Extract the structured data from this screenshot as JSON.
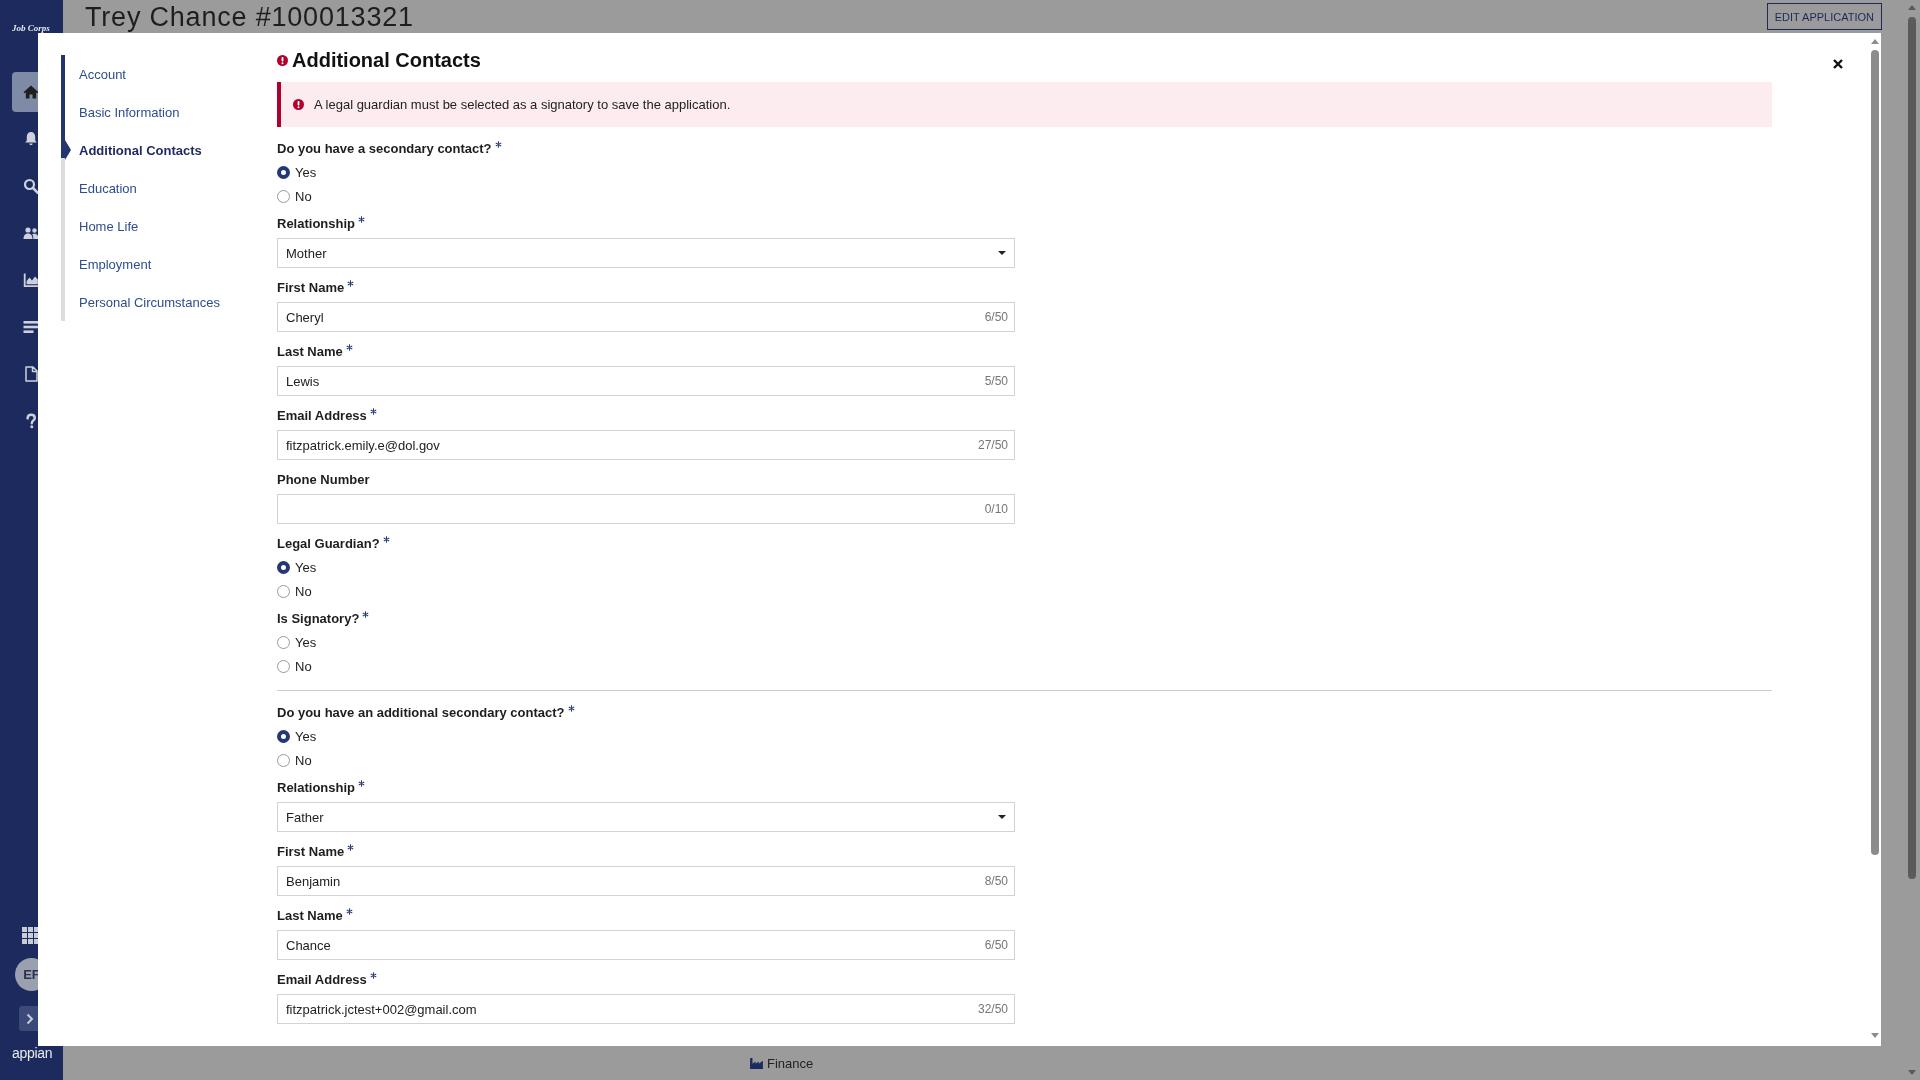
{
  "app_sidebar": {
    "logo": "Job Corps",
    "nav": [
      {
        "kind": "home",
        "selected": true
      },
      {
        "kind": "bell",
        "selected": false
      },
      {
        "kind": "search",
        "selected": false
      },
      {
        "kind": "people",
        "selected": false
      },
      {
        "kind": "chart",
        "selected": false
      },
      {
        "kind": "list",
        "selected": false
      },
      {
        "kind": "document",
        "selected": false
      },
      {
        "kind": "help",
        "selected": false
      }
    ],
    "avatar": "EF",
    "brand": "appian"
  },
  "page": {
    "title": "Trey Chance #100013321",
    "edit_button": "EDIT APPLICATION",
    "footer_link": "Finance"
  },
  "modal": {
    "nav": [
      {
        "label": "Account",
        "selected": false
      },
      {
        "label": "Basic Information",
        "selected": false
      },
      {
        "label": "Additional Contacts",
        "selected": true
      },
      {
        "label": "Education",
        "selected": false
      },
      {
        "label": "Home Life",
        "selected": false
      },
      {
        "label": "Employment",
        "selected": false
      },
      {
        "label": "Personal Circumstances",
        "selected": false
      }
    ],
    "title": "Additional Contacts",
    "has_error": true,
    "error_banner": "A legal guardian must be selected as a signatory to save the application.",
    "sections": [
      {
        "fields": [
          {
            "kind": "radio",
            "label": "Do you have a secondary contact?",
            "required": true,
            "options": [
              {
                "label": "Yes",
                "selected": true
              },
              {
                "label": "No",
                "selected": false
              }
            ]
          },
          {
            "kind": "select",
            "label": "Relationship",
            "required": true,
            "value": "Mother"
          },
          {
            "kind": "text",
            "label": "First Name",
            "required": true,
            "value": "Cheryl",
            "counter": "6/50"
          },
          {
            "kind": "text",
            "label": "Last Name",
            "required": true,
            "value": "Lewis",
            "counter": "5/50"
          },
          {
            "kind": "text",
            "label": "Email Address",
            "required": true,
            "value": "fitzpatrick.emily.e@dol.gov",
            "counter": "27/50"
          },
          {
            "kind": "text",
            "label": "Phone Number",
            "required": false,
            "counter": "0/10"
          },
          {
            "kind": "radio",
            "label": "Legal Guardian?",
            "required": true,
            "options": [
              {
                "label": "Yes",
                "selected": true
              },
              {
                "label": "No",
                "selected": false
              }
            ]
          },
          {
            "kind": "radio",
            "label": "Is Signatory?",
            "required": true,
            "options": [
              {
                "label": "Yes",
                "selected": false
              },
              {
                "label": "No",
                "selected": false
              }
            ]
          }
        ]
      },
      {
        "fields": [
          {
            "kind": "radio",
            "label": "Do you have an additional secondary contact?",
            "required": true,
            "options": [
              {
                "label": "Yes",
                "selected": true
              },
              {
                "label": "No",
                "selected": false
              }
            ]
          },
          {
            "kind": "select",
            "label": "Relationship",
            "required": true,
            "value": "Father"
          },
          {
            "kind": "text",
            "label": "First Name",
            "required": true,
            "value": "Benjamin",
            "counter": "8/50"
          },
          {
            "kind": "text",
            "label": "Last Name",
            "required": true,
            "value": "Chance",
            "counter": "6/50"
          },
          {
            "kind": "text",
            "label": "Email Address",
            "required": true,
            "value": "fitzpatrick.jctest+002@gmail.com",
            "counter": "32/50"
          }
        ]
      }
    ]
  }
}
